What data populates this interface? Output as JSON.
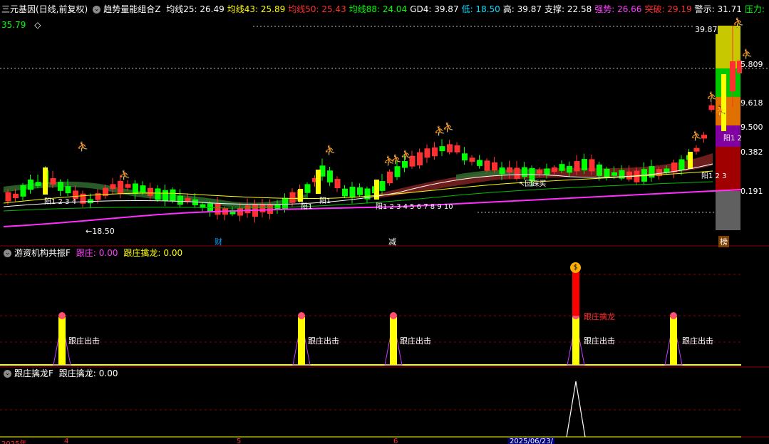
{
  "main_header": {
    "stock_name": "三元基因(日线,前复权)",
    "indicator_name": "趋势量能组合Z",
    "items": [
      {
        "label": "均线25:",
        "value": "26.49",
        "color": "#ffffff"
      },
      {
        "label": "均线43:",
        "value": "25.89",
        "color": "#ffff00"
      },
      {
        "label": "均线50:",
        "value": "25.43",
        "color": "#ff3030"
      },
      {
        "label": "均线88:",
        "value": "24.04",
        "color": "#00ff00"
      },
      {
        "label": "GD4:",
        "value": "39.87",
        "color": "#ffffff"
      },
      {
        "label": "低:",
        "value": "18.50",
        "color": "#00e0ff"
      },
      {
        "label": "高:",
        "value": "39.87",
        "color": "#ffffff"
      },
      {
        "label": "支撑:",
        "value": "22.58",
        "color": "#ffffff"
      },
      {
        "label": "强势:",
        "value": "26.66",
        "color": "#ff40ff"
      },
      {
        "label": "突破:",
        "value": "29.19",
        "color": "#ff3030"
      },
      {
        "label": "警示:",
        "value": "31.71",
        "color": "#ffffff"
      },
      {
        "label": "压力:",
        "value": "35.79",
        "color": "#00ff00"
      }
    ],
    "diamond": "◇"
  },
  "price_labels": {
    "high": "39.87",
    "low": "←18.50",
    "levels": [
      "5.809",
      "9.618",
      "9.500",
      "0.382",
      "0.191"
    ],
    "yang_labels": [
      "阳1 2 3 4",
      "阳1",
      "阳1",
      "阳1 2 3 4 5 6 7 8 9 10",
      "阳1 2",
      "阳1 2 3"
    ],
    "callback": "回踩买"
  },
  "markers": {
    "cai": "财",
    "jian": "减",
    "bang": "榜"
  },
  "panel2_header": {
    "name": "游资机构共振F",
    "item1_label": "跟庄:",
    "item1_value": "0.00",
    "item2_label": "跟庄擒龙:",
    "item2_value": "0.00"
  },
  "panel2_labels": {
    "follow_out": "跟庄出击",
    "dragon": "跟庄擒龙",
    "money_icon": "$"
  },
  "panel3_header": {
    "name": "跟庄擒龙F",
    "item_label": "跟庄擒龙:",
    "item_value": "0.00"
  },
  "time_axis": {
    "labels": [
      "2025年",
      "4",
      "5",
      "6",
      "2025/06/23/"
    ]
  },
  "colors": {
    "up": "#ff3030",
    "down": "#00ff00",
    "ma_white": "#ffffff",
    "ma_yellow": "#ffff00",
    "ma_pink": "#ff30ff",
    "bar_yellow": "#ffff00"
  }
}
